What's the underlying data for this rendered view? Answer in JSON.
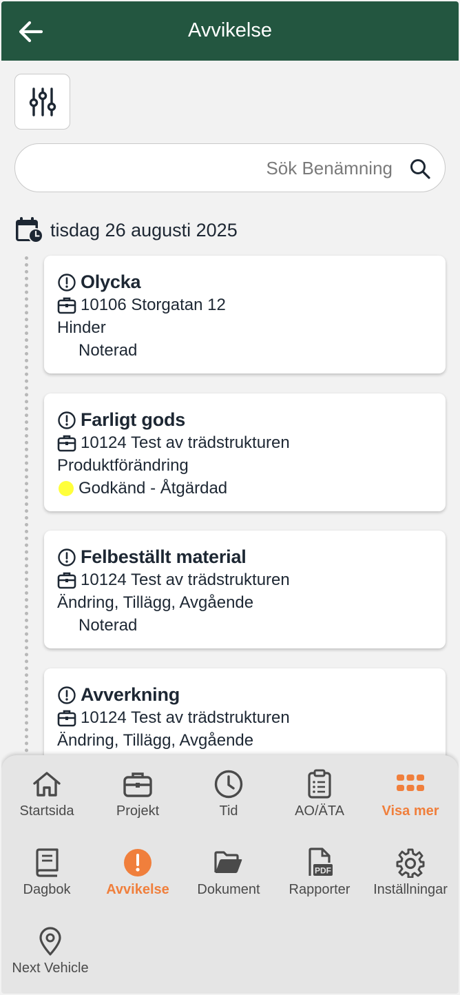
{
  "header": {
    "title": "Avvikelse"
  },
  "search": {
    "placeholder": "Sök Benämning",
    "value": ""
  },
  "date_label": "tisdag 26 augusti 2025",
  "deviations": [
    {
      "title": "Olycka",
      "project": "10106 Storgatan 12",
      "category": "Hinder",
      "status": "Noterad",
      "status_color": ""
    },
    {
      "title": "Farligt gods",
      "project": "10124 Test av trädstrukturen",
      "category": "Produktförändring",
      "status": "Godkänd - Åtgärdad",
      "status_color": "#ffff3b"
    },
    {
      "title": "Felbeställt material",
      "project": "10124 Test av trädstrukturen",
      "category": "Ändring, Tillägg, Avgående",
      "status": "Noterad",
      "status_color": ""
    },
    {
      "title": "Avverkning",
      "project": "10124 Test av trädstrukturen",
      "category": "Ändring, Tillägg, Avgående",
      "status": "",
      "status_color": ""
    }
  ],
  "nav": {
    "row1": [
      {
        "label": "Startsida",
        "icon": "home-icon",
        "active": false
      },
      {
        "label": "Projekt",
        "icon": "briefcase-icon",
        "active": false
      },
      {
        "label": "Tid",
        "icon": "clock-icon",
        "active": false
      },
      {
        "label": "AO/ÄTA",
        "icon": "clipboard-list-icon",
        "active": false
      },
      {
        "label": "Visa mer",
        "icon": "grid-dots-icon",
        "active": true
      }
    ],
    "row2": [
      {
        "label": "Dagbok",
        "icon": "book-icon",
        "active": false
      },
      {
        "label": "Avvikelse",
        "icon": "exclamation-circle-icon",
        "active": true
      },
      {
        "label": "Dokument",
        "icon": "folder-open-icon",
        "active": false
      },
      {
        "label": "Rapporter",
        "icon": "pdf-file-icon",
        "active": false
      },
      {
        "label": "Inställningar",
        "icon": "gear-icon",
        "active": false
      }
    ],
    "row3": [
      {
        "label": "Next Vehicle",
        "icon": "map-pin-icon",
        "active": false
      }
    ]
  },
  "colors": {
    "header_bg": "#235640",
    "accent": "#f07f3c",
    "nav_bg": "#e5e5e5",
    "page_bg": "#f2f2f2"
  }
}
